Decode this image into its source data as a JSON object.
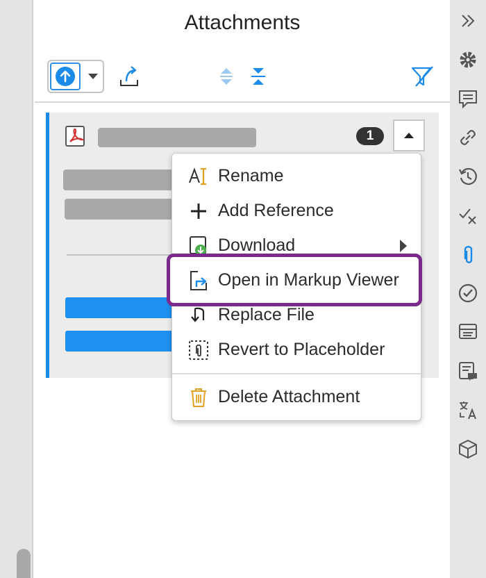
{
  "panel": {
    "title": "Attachments"
  },
  "toolbar": {
    "upload_icon": "upload-arrow-icon",
    "upload_dropdown_icon": "caret-down-icon",
    "share_icon": "share-out-icon",
    "expand_icon": "expand-all-icon",
    "collapse_icon": "collapse-all-icon",
    "filter_icon": "filter-off-icon",
    "accent_color": "#1b8ae8"
  },
  "attachment": {
    "file_icon": "pdf-icon",
    "reference_count": "1",
    "collapse_icon": "caret-up-icon"
  },
  "menu": {
    "items": [
      {
        "label": "Rename",
        "icon": "rename-text-cursor-icon"
      },
      {
        "label": "Add Reference",
        "icon": "plus-icon"
      },
      {
        "label": "Download",
        "icon": "download-icon",
        "has_submenu": true
      },
      {
        "label": "Open in Markup Viewer",
        "icon": "open-external-icon",
        "highlighted": true
      },
      {
        "label": "Replace File",
        "icon": "replace-file-icon"
      },
      {
        "label": "Revert to Placeholder",
        "icon": "paperclip-placeholder-icon"
      },
      {
        "label": "Delete Attachment",
        "icon": "trash-icon"
      }
    ],
    "highlight_color": "#7b2a8c"
  },
  "rail": {
    "icons": [
      "chevron-double-right-icon",
      "gear-icon",
      "comment-icon",
      "link-icon",
      "history-icon",
      "checkmark-x-icon",
      "paperclip-icon",
      "check-circle-icon",
      "message-stack-icon",
      "note-icon",
      "translate-icon",
      "cube-icon"
    ],
    "active_icon": "paperclip-icon"
  }
}
